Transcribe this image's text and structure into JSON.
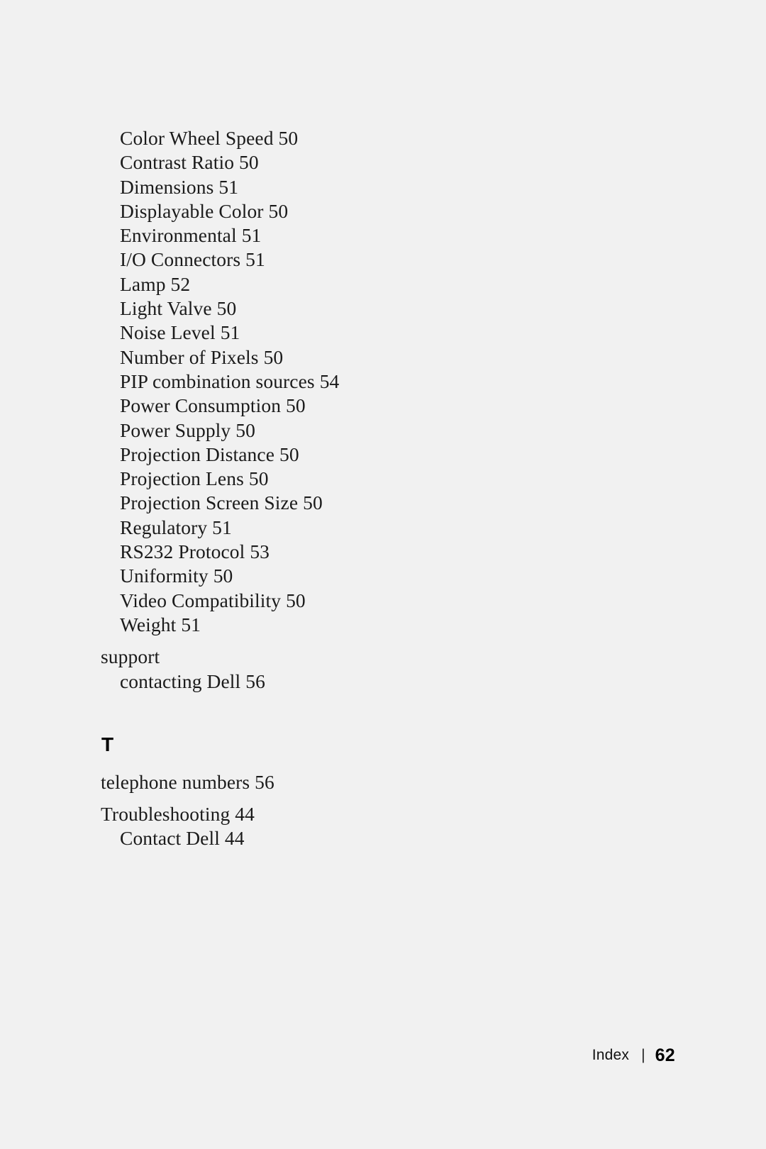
{
  "document": {
    "background_color": "#f1f1f1",
    "text_color": "#1b1b1b"
  },
  "index": {
    "entries": [
      {
        "text": "Color Wheel Speed 50",
        "level": 2,
        "gap_before": false
      },
      {
        "text": "Contrast Ratio 50",
        "level": 2,
        "gap_before": false
      },
      {
        "text": "Dimensions 51",
        "level": 2,
        "gap_before": false
      },
      {
        "text": "Displayable Color 50",
        "level": 2,
        "gap_before": false
      },
      {
        "text": "Environmental 51",
        "level": 2,
        "gap_before": false
      },
      {
        "text": "I/O Connectors 51",
        "level": 2,
        "gap_before": false
      },
      {
        "text": "Lamp 52",
        "level": 2,
        "gap_before": false
      },
      {
        "text": "Light Valve 50",
        "level": 2,
        "gap_before": false
      },
      {
        "text": "Noise Level 51",
        "level": 2,
        "gap_before": false
      },
      {
        "text": "Number of Pixels 50",
        "level": 2,
        "gap_before": false
      },
      {
        "text": "PIP combination sources 54",
        "level": 2,
        "gap_before": false
      },
      {
        "text": "Power Consumption 50",
        "level": 2,
        "gap_before": false
      },
      {
        "text": "Power Supply 50",
        "level": 2,
        "gap_before": false
      },
      {
        "text": "Projection Distance 50",
        "level": 2,
        "gap_before": false
      },
      {
        "text": "Projection Lens 50",
        "level": 2,
        "gap_before": false
      },
      {
        "text": "Projection Screen Size 50",
        "level": 2,
        "gap_before": false
      },
      {
        "text": "Regulatory 51",
        "level": 2,
        "gap_before": false
      },
      {
        "text": "RS232 Protocol 53",
        "level": 2,
        "gap_before": false
      },
      {
        "text": "Uniformity 50",
        "level": 2,
        "gap_before": false
      },
      {
        "text": "Video Compatibility 50",
        "level": 2,
        "gap_before": false
      },
      {
        "text": "Weight 51",
        "level": 2,
        "gap_before": false
      },
      {
        "text": "support",
        "level": 1,
        "gap_before": true
      },
      {
        "text": "contacting Dell 56",
        "level": 2,
        "gap_before": false
      }
    ],
    "section": {
      "letter": "T",
      "entries": [
        {
          "text": "telephone numbers 56",
          "level": 1,
          "gap_before": false
        },
        {
          "text": "Troubleshooting 44",
          "level": 1,
          "gap_before": true
        },
        {
          "text": "Contact Dell 44",
          "level": 2,
          "gap_before": false
        }
      ]
    }
  },
  "footer": {
    "label": "Index",
    "separator": "|",
    "page_number": "62"
  }
}
